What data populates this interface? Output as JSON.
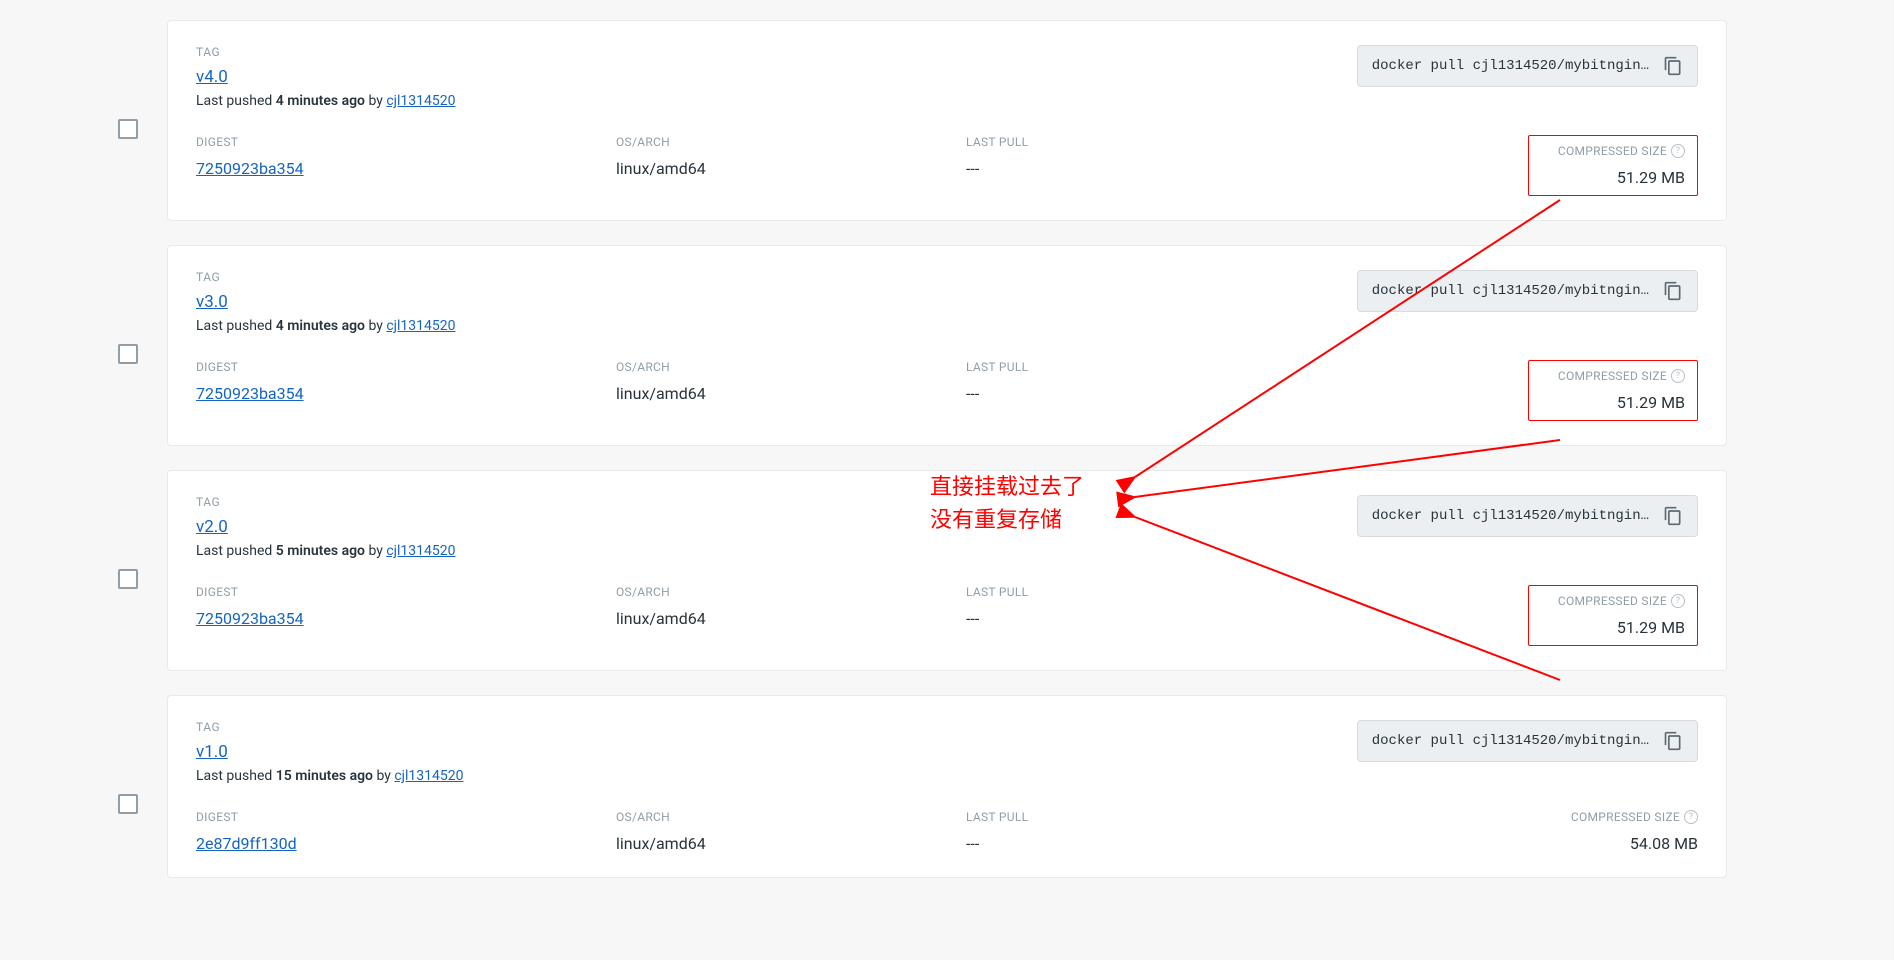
{
  "labels": {
    "tag": "TAG",
    "digest": "DIGEST",
    "osarch": "OS/ARCH",
    "lastpull": "LAST PULL",
    "size": "COMPRESSED SIZE",
    "last_pushed_prefix": "Last pushed ",
    "by": " by "
  },
  "annotation": {
    "line1": "直接挂载过去了",
    "line2": "没有重复存储"
  },
  "tags": [
    {
      "name": "v4.0",
      "pushed_ago": "4 minutes ago",
      "author": "cjl1314520",
      "pull_cmd": "docker pull cjl1314520/mybitngin…",
      "digest": "7250923ba354",
      "osarch": "linux/amd64",
      "lastpull": "---",
      "size": "51.29 MB",
      "highlight": true
    },
    {
      "name": "v3.0",
      "pushed_ago": "4 minutes ago",
      "author": "cjl1314520",
      "pull_cmd": "docker pull cjl1314520/mybitngin…",
      "digest": "7250923ba354",
      "osarch": "linux/amd64",
      "lastpull": "---",
      "size": "51.29 MB",
      "highlight": true
    },
    {
      "name": "v2.0",
      "pushed_ago": "5 minutes ago",
      "author": "cjl1314520",
      "pull_cmd": "docker pull cjl1314520/mybitngin…",
      "digest": "7250923ba354",
      "osarch": "linux/amd64",
      "lastpull": "---",
      "size": "51.29 MB",
      "highlight": true
    },
    {
      "name": "v1.0",
      "pushed_ago": "15 minutes ago",
      "author": "cjl1314520",
      "pull_cmd": "docker pull cjl1314520/mybitngin…",
      "digest": "2e87d9ff130d",
      "osarch": "linux/amd64",
      "lastpull": "---",
      "size": "54.08 MB",
      "highlight": false
    }
  ]
}
